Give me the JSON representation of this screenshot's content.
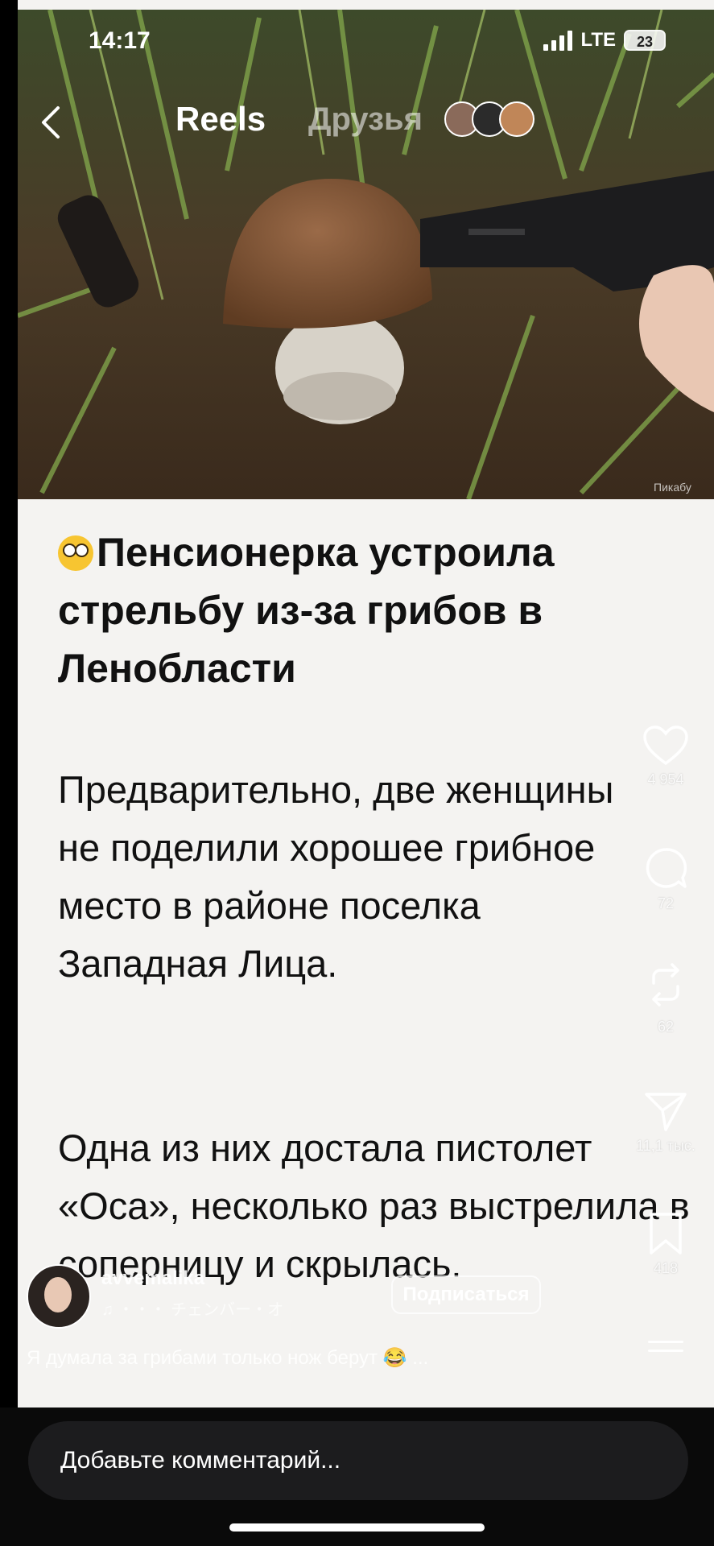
{
  "status": {
    "time": "14:17",
    "network": "LTE",
    "battery": "23"
  },
  "nav": {
    "reels": "Reels",
    "friends": "Друзья"
  },
  "post": {
    "headline": "Пенсионерка устроила стрельбу из-за грибов в Ленобласти",
    "para1": "Предварительно, две женщины не поделили хорошее грибное место в районе поселка Западная Лица.",
    "para2": "Одна из них достала пистолет «Оса», несколько раз выстрелила в соперницу и скрылась.",
    "photo_credit": "Пикабу"
  },
  "actions": {
    "likes": "4 954",
    "comments": "72",
    "reposts": "62",
    "shares": "11,1 тыс.",
    "saves": "418"
  },
  "author": {
    "username": "avvemalika",
    "audio": "♫ ・・・ チェンバー・オ",
    "subscribe": "Подписаться"
  },
  "caption": "Я думала за грибами только нож берут 😂 ...",
  "comment_placeholder": "Добавьте комментарий...",
  "colors": {
    "text": "#111111",
    "background": "#f4f3f1",
    "bar": "#0a0a0a"
  }
}
